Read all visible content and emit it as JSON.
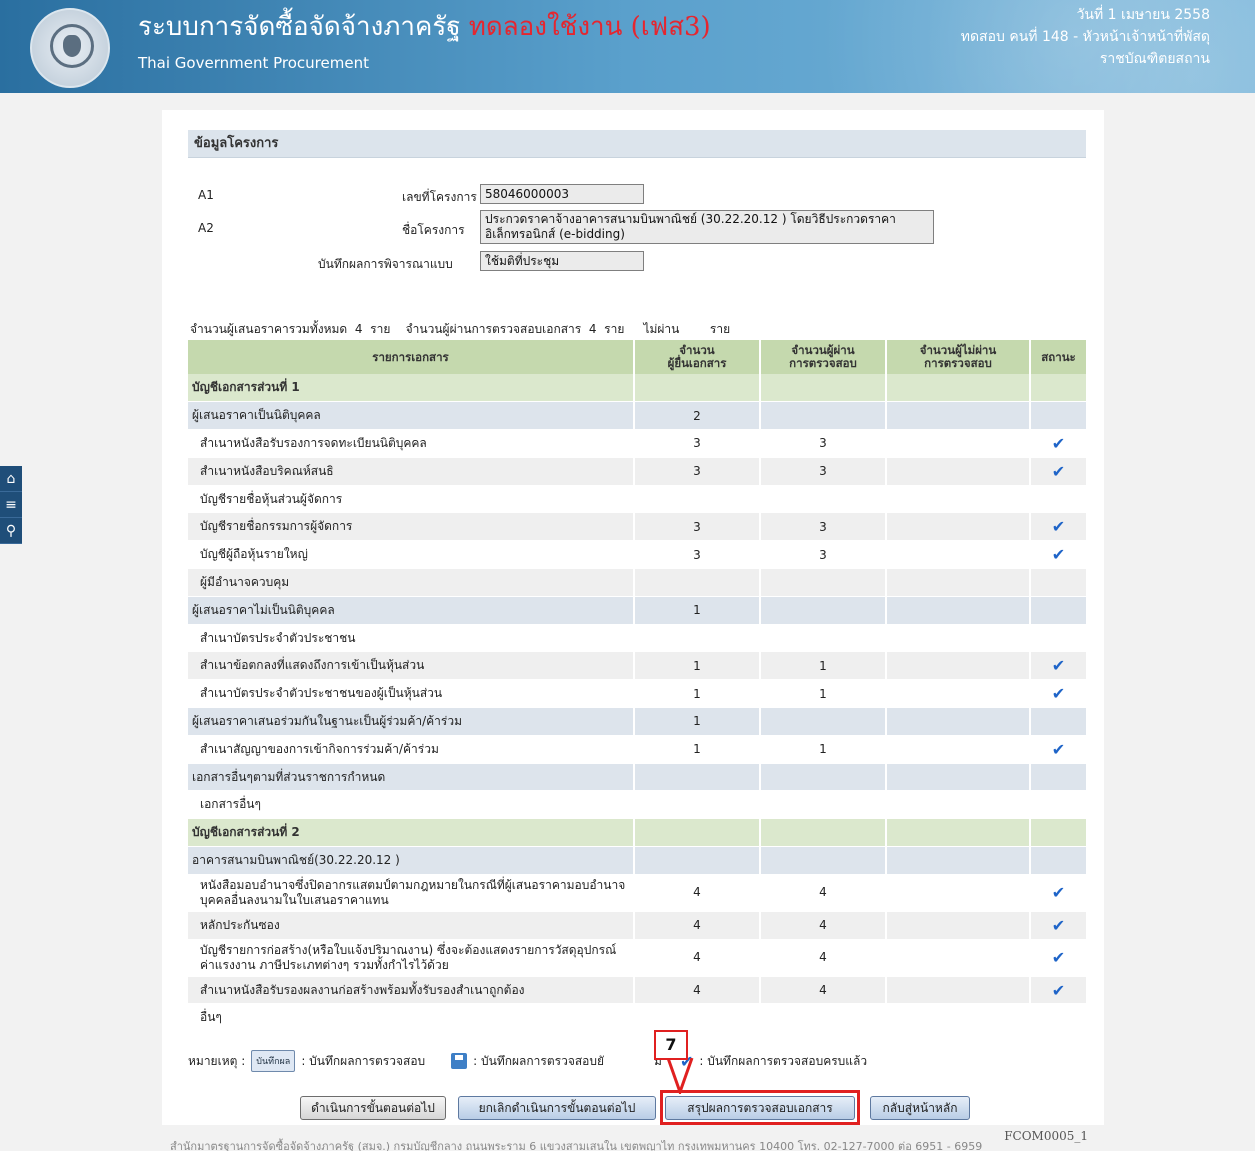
{
  "header": {
    "title_th": "ระบบการจัดซื้อจัดจ้างภาครัฐ",
    "title_test": "ทดลองใช้งาน (เฟส3)",
    "title_en": "Thai Government Procurement",
    "date": "วันที่ 1 เมษายน 2558",
    "user": "ทดสอบ คนที่ 148 - หัวหน้าเจ้าหน้าที่พัสดุ",
    "org": "ราชบัณฑิตยสถาน"
  },
  "sidenav": {
    "icons": [
      "home-icon",
      "menu-icon",
      "search-icon"
    ],
    "glyphs": [
      "⌂",
      "≡",
      "⚲"
    ]
  },
  "section_title": "ข้อมูลโครงการ",
  "form": {
    "a1_code": "A1",
    "a1_label": "เลขที่โครงการ",
    "a1_value": "58046000003",
    "a2_code": "A2",
    "a2_label": "ชื่อโครงการ",
    "a2_value": "ประกวดราคาจ้างอาคารสนามบินพาณิชย์ (30.22.20.12 ) โดยวิธีประกวดราคาอิเล็กทรอนิกส์ (e-bidding)",
    "mode_label": "บันทึกผลการพิจารณาแบบ",
    "mode_value": "ใช้มติที่ประชุม"
  },
  "summary": {
    "total_label": "จำนวนผู้เสนอราคารวมทั้งหมด",
    "total_value": "4",
    "unit1": "ราย",
    "passed_label": "จำนวนผู้ผ่านการตรวจสอบเอกสาร",
    "passed_value": "4",
    "unit2": "ราย",
    "failed_label": "ไม่ผ่าน",
    "unit3": "ราย"
  },
  "table": {
    "headers": [
      "รายการเอกสาร",
      "จำนวน\nผู้ยื่นเอกสาร",
      "จำนวนผู้ผ่าน\nการตรวจสอบ",
      "จำนวนผู้ไม่ผ่าน\nการตรวจสอบ",
      "สถานะ"
    ],
    "rows": [
      {
        "type": "sec",
        "name": "บัญชีเอกสารส่วนที่ 1",
        "c1": "",
        "c2": "",
        "c3": "",
        "check": false
      },
      {
        "type": "grp",
        "name": "ผู้เสนอราคาเป็นนิติบุคคล",
        "c1": "2",
        "c2": "",
        "c3": "",
        "check": false
      },
      {
        "type": "itm",
        "name": "สำเนาหนังสือรับรองการจดทะเบียนนิติบุคคล",
        "c1": "3",
        "c2": "3",
        "c3": "",
        "check": true
      },
      {
        "type": "itm",
        "name": "สำเนาหนังสือบริคณห์สนธิ",
        "c1": "3",
        "c2": "3",
        "c3": "",
        "check": true
      },
      {
        "type": "itm",
        "name": "บัญชีรายชื่อหุ้นส่วนผู้จัดการ",
        "c1": "",
        "c2": "",
        "c3": "",
        "check": false
      },
      {
        "type": "itm",
        "name": "บัญชีรายชื่อกรรมการผู้จัดการ",
        "c1": "3",
        "c2": "3",
        "c3": "",
        "check": true
      },
      {
        "type": "itm",
        "name": "บัญชีผู้ถือหุ้นรายใหญ่",
        "c1": "3",
        "c2": "3",
        "c3": "",
        "check": true
      },
      {
        "type": "itm",
        "name": "ผู้มีอำนาจควบคุม",
        "c1": "",
        "c2": "",
        "c3": "",
        "check": false
      },
      {
        "type": "grp",
        "name": "ผู้เสนอราคาไม่เป็นนิติบุคคล",
        "c1": "1",
        "c2": "",
        "c3": "",
        "check": false
      },
      {
        "type": "itm",
        "name": "สำเนาบัตรประจำตัวประชาชน",
        "c1": "",
        "c2": "",
        "c3": "",
        "check": false
      },
      {
        "type": "itm",
        "name": "สำเนาข้อตกลงที่แสดงถึงการเข้าเป็นหุ้นส่วน",
        "c1": "1",
        "c2": "1",
        "c3": "",
        "check": true
      },
      {
        "type": "itm",
        "name": "สำเนาบัตรประจำตัวประชาชนของผู้เป็นหุ้นส่วน",
        "c1": "1",
        "c2": "1",
        "c3": "",
        "check": true
      },
      {
        "type": "grp",
        "name": "ผู้เสนอราคาเสนอร่วมกันในฐานะเป็นผู้ร่วมค้า/ค้าร่วม",
        "c1": "1",
        "c2": "",
        "c3": "",
        "check": false
      },
      {
        "type": "itm",
        "name": "สำเนาสัญญาของการเข้ากิจการร่วมค้า/ค้าร่วม",
        "c1": "1",
        "c2": "1",
        "c3": "",
        "check": true
      },
      {
        "type": "grp",
        "name": "เอกสารอื่นๆตามที่ส่วนราชการกำหนด",
        "c1": "",
        "c2": "",
        "c3": "",
        "check": false
      },
      {
        "type": "itm",
        "name": "เอกสารอื่นๆ",
        "c1": "",
        "c2": "",
        "c3": "",
        "check": false
      },
      {
        "type": "sec",
        "name": "บัญชีเอกสารส่วนที่ 2",
        "c1": "",
        "c2": "",
        "c3": "",
        "check": false
      },
      {
        "type": "grp",
        "name": "อาคารสนามบินพาณิชย์(30.22.20.12 )",
        "c1": "",
        "c2": "",
        "c3": "",
        "check": false
      },
      {
        "type": "itm",
        "tall": true,
        "name": "หนังสือมอบอำนาจซึ่งปิดอากรแสตมป์ตามกฎหมายในกรณีที่ผู้เสนอราคามอบอำนาจบุคคลอื่นลงนามในใบเสนอราคาแทน",
        "c1": "4",
        "c2": "4",
        "c3": "",
        "check": true
      },
      {
        "type": "itm",
        "name": "หลักประกันซอง",
        "c1": "4",
        "c2": "4",
        "c3": "",
        "check": true
      },
      {
        "type": "itm",
        "tall": true,
        "name": "บัญชีรายการก่อสร้าง(หรือใบแจ้งปริมาณงาน) ซึ่งจะต้องแสดงรายการวัสดุอุปกรณ์ ค่าแรงงาน ภาษีประเภทต่างๆ รวมทั้งกำไรไว้ด้วย",
        "c1": "4",
        "c2": "4",
        "c3": "",
        "check": true
      },
      {
        "type": "itm",
        "name": "สำเนาหนังสือรับรองผลงานก่อสร้างพร้อมทั้งรับรองสำเนาถูกต้อง",
        "c1": "4",
        "c2": "4",
        "c3": "",
        "check": true
      },
      {
        "type": "itm",
        "name": "อื่นๆ",
        "c1": "",
        "c2": "",
        "c3": "",
        "check": false
      }
    ]
  },
  "legend": {
    "label": "หมายเหตุ :",
    "btn_label": "บันทึกผล",
    "text1": ": บันทึกผลการตรวจสอบ",
    "text2": ": บันทึกผลการตรวจสอบยั",
    "text2_tail": "ม",
    "check_glyph": "✔",
    "text3": ": บันทึกผลการตรวจสอบครบแล้ว"
  },
  "buttons": {
    "next": "ดำเนินการขั้นตอนต่อไป",
    "cancel_next": "ยกเลิกดำเนินการขั้นตอนต่อไป",
    "summary": "สรุปผลการตรวจสอบเอกสาร",
    "home": "กลับสู่หน้าหลัก"
  },
  "callout_number": "7",
  "page_code": "FCOM0005_1",
  "footer": "สำนักมาตรฐานการจัดซื้อจัดจ้างภาครัฐ (สมจ.) กรมบัญชีกลาง ถนนพระราม 6 แขวงสามเสนใน เขตพญาไท กรุงเทพมหานคร 10400 โทร. 02-127-7000 ต่อ 6951 - 6959",
  "colors": {
    "accent_red": "#e02020",
    "check_blue": "#1e64c8",
    "section_green": "#dbe8cd",
    "header_green": "#c5d9ae"
  }
}
